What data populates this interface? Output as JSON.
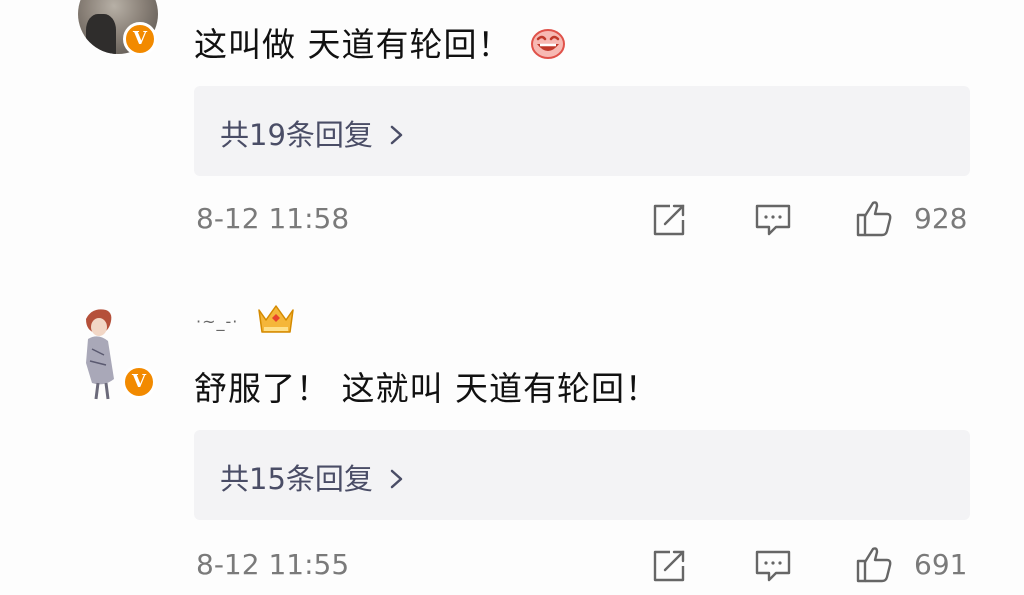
{
  "colors": {
    "badge": "#f28a00",
    "reply_link": "#4a4d66",
    "meta_text": "#7a7a7a",
    "reply_box_bg": "#f3f3f5"
  },
  "comments": [
    {
      "username": "",
      "avatar_icon": "avatar-photo",
      "badge_label": "V",
      "text": "这叫做 天道有轮回！",
      "emoji_icon": "laughing-face-icon",
      "replies_label": "共19条回复",
      "timestamp": "8-12 11:58",
      "like_count": "928"
    },
    {
      "username": "·~_-·",
      "avatar_icon": "avatar-illustration",
      "badge_label": "V",
      "crown_icon": "crown-icon",
      "text": "舒服了！ 这就叫 天道有轮回！",
      "replies_label": "共15条回复",
      "timestamp": "8-12 11:55",
      "like_count": "691"
    }
  ]
}
